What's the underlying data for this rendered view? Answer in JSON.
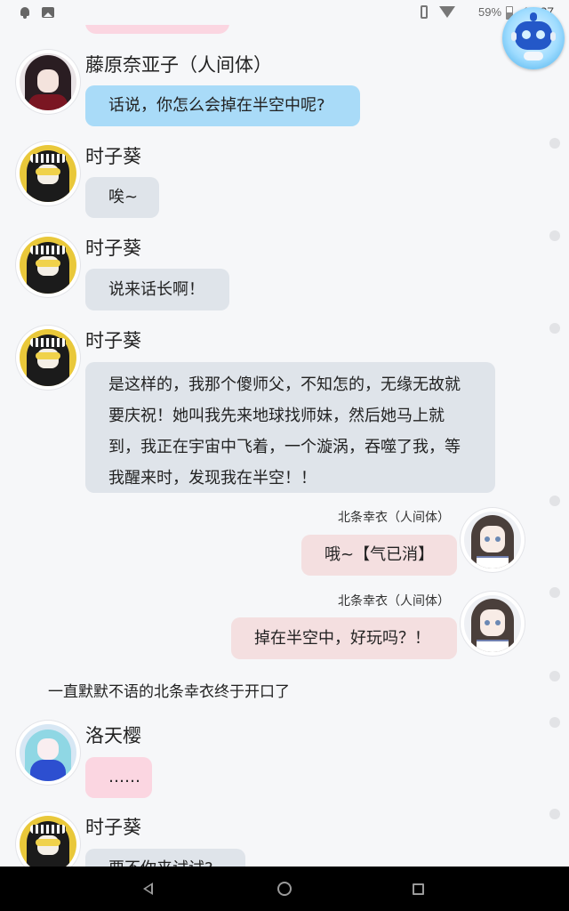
{
  "status_bar": {
    "battery_percent": "59%",
    "time": "13:27",
    "icons": [
      "notification-bell-icon",
      "image-icon",
      "vibrate-icon",
      "wifi-icon",
      "battery-icon"
    ]
  },
  "assistant": {
    "icon": "robot-assistant-icon"
  },
  "messages": [
    {
      "side": "left",
      "sender": "藤原奈亚子（人间体）",
      "text": "话说，你怎么会掉在半空中呢?",
      "bubble_color": "#a9dbf8"
    },
    {
      "side": "left",
      "sender": "时子葵",
      "text": "唉~",
      "bubble_color": "#dfe4ea"
    },
    {
      "side": "left",
      "sender": "时子葵",
      "text": "说来话长啊！",
      "bubble_color": "#dfe4ea"
    },
    {
      "side": "left",
      "sender": "时子葵",
      "lines": [
        "是这样的，我那个傻师父，不知怎的，无缘无故就",
        "要庆祝！她叫我先来地球找师妹，然后她马上就",
        "到，我正在宇宙中飞着，一个漩涡，吞噬了我，等",
        "我醒来时，发现我在半空！！"
      ],
      "bubble_color": "#dfe4ea"
    },
    {
      "side": "right",
      "sender": "北条幸衣（人间体）",
      "text": "哦~【气已消】",
      "bubble_color": "#f4dfe0"
    },
    {
      "side": "right",
      "sender": "北条幸衣（人间体）",
      "text": "掉在半空中，好玩吗？！",
      "bubble_color": "#f4dfe0"
    },
    {
      "side": "narration",
      "text": "一直默默不语的北条幸衣终于开口了"
    },
    {
      "side": "left",
      "sender": "洛天樱",
      "text": "……",
      "bubble_color": "#fbd6e1"
    },
    {
      "side": "left",
      "sender": "时子葵",
      "text": "要不你来试试?",
      "bubble_color": "#dfe4ea"
    }
  ],
  "nav": {
    "icons": [
      "back-icon",
      "home-icon",
      "recent-apps-icon"
    ]
  }
}
